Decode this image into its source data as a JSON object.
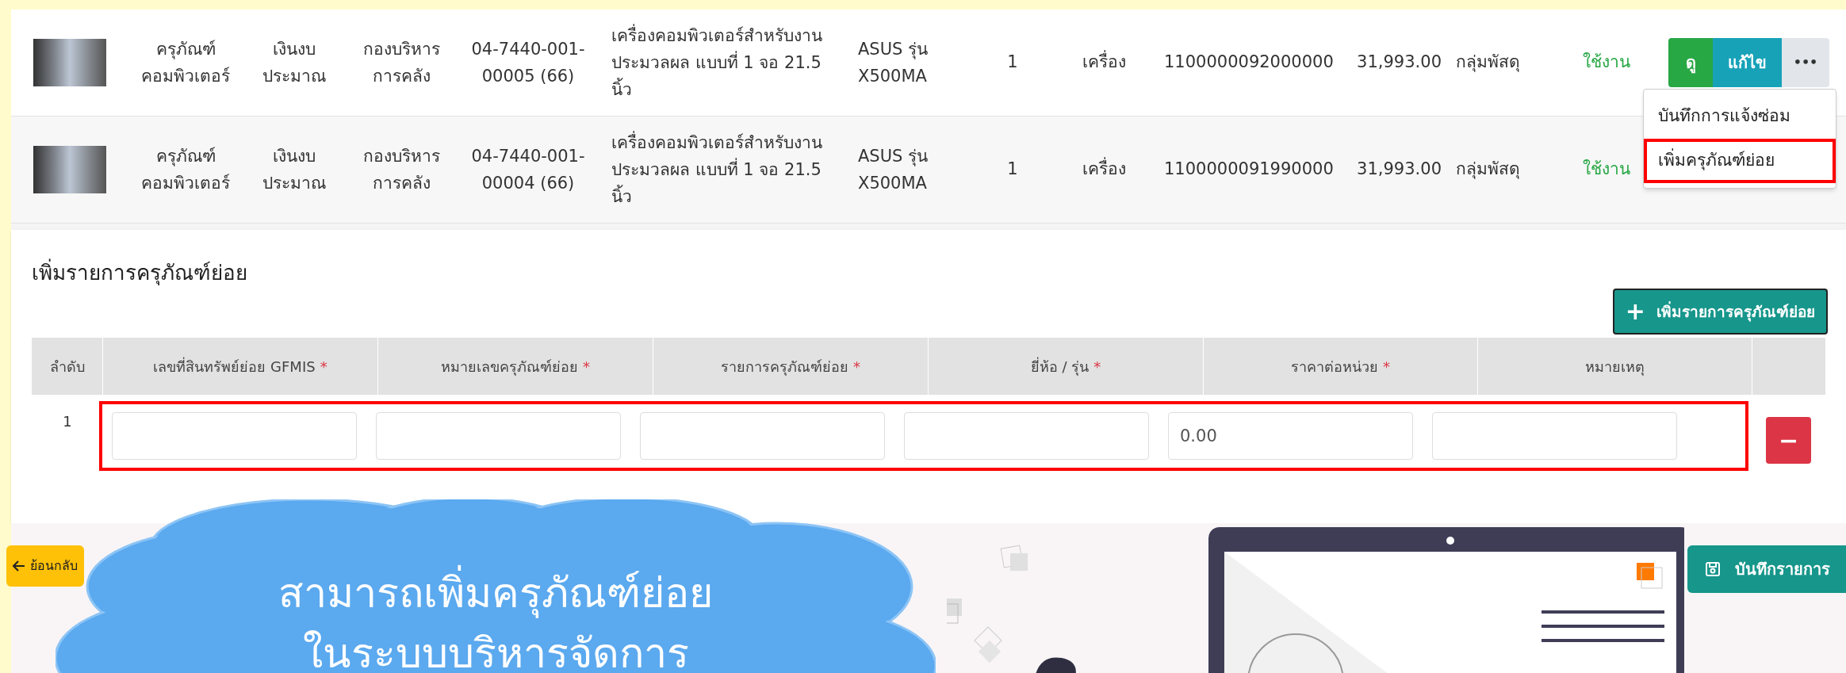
{
  "rows": [
    {
      "category": [
        "ครุภัณฑ์",
        "คอมพิวเตอร์"
      ],
      "budget": [
        "เงินงบ",
        "ประมาณ"
      ],
      "department": [
        "กองบริหาร",
        "การคลัง"
      ],
      "asset_no": [
        "04-7440-001-",
        "00005 (66)"
      ],
      "description": [
        "เครื่องคอมพิวเตอร์สำหรับงาน",
        "ประมวลผล แบบที่ 1 จอ 21.5",
        "นิ้ว"
      ],
      "brand": [
        "ASUS รุ่น",
        "X500MA"
      ],
      "quantity": "1",
      "unit": "เครื่อง",
      "gfmis": "1100000092000000",
      "price": "31,993.00",
      "owner": "กลุ่มพัสดุ",
      "status": "ใช้งาน",
      "actions": {
        "view": "ดู",
        "edit": "แก้ไข",
        "more": "•••"
      }
    },
    {
      "category": [
        "ครุภัณฑ์",
        "คอมพิวเตอร์"
      ],
      "budget": [
        "เงินงบ",
        "ประมาณ"
      ],
      "department": [
        "กองบริหาร",
        "การคลัง"
      ],
      "asset_no": [
        "04-7440-001-",
        "00004 (66)"
      ],
      "description": [
        "เครื่องคอมพิวเตอร์สำหรับงาน",
        "ประมวลผล แบบที่ 1 จอ 21.5",
        "นิ้ว"
      ],
      "brand": [
        "ASUS รุ่น",
        "X500MA"
      ],
      "quantity": "1",
      "unit": "เครื่อง",
      "gfmis": "1100000091990000",
      "price": "31,993.00",
      "owner": "กลุ่มพัสดุ",
      "status": "ใช้งาน"
    }
  ],
  "dropdown_menu": [
    {
      "label": "บันทึกการแจ้งซ่อม",
      "highlighted": false
    },
    {
      "label": "เพิ่มครุภัณฑ์ย่อย",
      "highlighted": true
    }
  ],
  "form": {
    "title": "เพิ่มรายการครุภัณฑ์ย่อย",
    "add_button": {
      "icon": "+",
      "label": "เพิ่มรายการครุภัณฑ์ย่อย"
    },
    "columns": [
      {
        "label": "ลำดับ"
      },
      {
        "label": "เลขที่สินทรัพย์ย่อย GFMIS",
        "mark": "*"
      },
      {
        "label": "หมายเลขครุภัณฑ์ย่อย",
        "mark": "*"
      },
      {
        "label": "รายการครุภัณฑ์ย่อย",
        "mark": "*"
      },
      {
        "label": "ยี่ห้อ / รุ่น",
        "mark": "*"
      },
      {
        "label": "ราคาต่อหน่วย",
        "mark": "*"
      },
      {
        "label": "หมายเหตุ"
      }
    ],
    "rows": [
      {
        "index": "1",
        "highlighted": true,
        "inputs": [
          {
            "kind": "text"
          },
          {
            "kind": "text"
          },
          {
            "kind": "text"
          },
          {
            "kind": "text"
          },
          {
            "kind": "amount",
            "value": "0.00"
          },
          {
            "kind": "text"
          }
        ],
        "remove_label": "−"
      }
    ]
  },
  "back_button": {
    "label": "ย้อนกลับ"
  },
  "save_button": {
    "label": "บันทึกรายการ"
  },
  "caption": {
    "lines": [
      "สามารถเพิ่มครุภัณฑ์ย่อย",
      "ในระบบบริหารจัดการ"
    ]
  }
}
